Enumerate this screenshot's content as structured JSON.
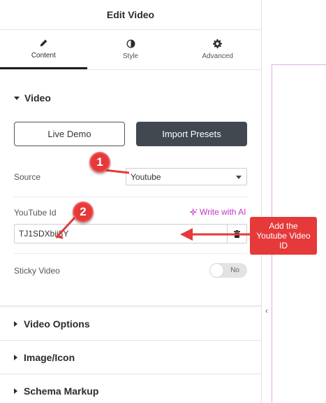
{
  "header": {
    "title": "Edit Video"
  },
  "tabs": [
    {
      "label": "Content",
      "icon": "pencil-icon"
    },
    {
      "label": "Style",
      "icon": "half-circle-icon"
    },
    {
      "label": "Advanced",
      "icon": "gear-icon"
    }
  ],
  "section_video": {
    "title": "Video"
  },
  "buttons": {
    "live_demo": "Live Demo",
    "import_presets": "Import Presets"
  },
  "source": {
    "label": "Source",
    "value": "Youtube"
  },
  "youtube": {
    "label": "YouTube Id",
    "ai_link": "Write with AI",
    "value": "TJ1SDXbij8Y"
  },
  "sticky": {
    "label": "Sticky Video",
    "toggle_text": "No"
  },
  "closed_sections": [
    {
      "title": "Video Options"
    },
    {
      "title": "Image/Icon"
    },
    {
      "title": "Schema Markup"
    }
  ],
  "annotations": {
    "badge1": "1",
    "badge2": "2",
    "callout": "Add the Youtube Video ID"
  },
  "colors": {
    "accent_ai": "#c036c9",
    "annotation_red": "#e5393a",
    "dark_button": "#414850"
  }
}
